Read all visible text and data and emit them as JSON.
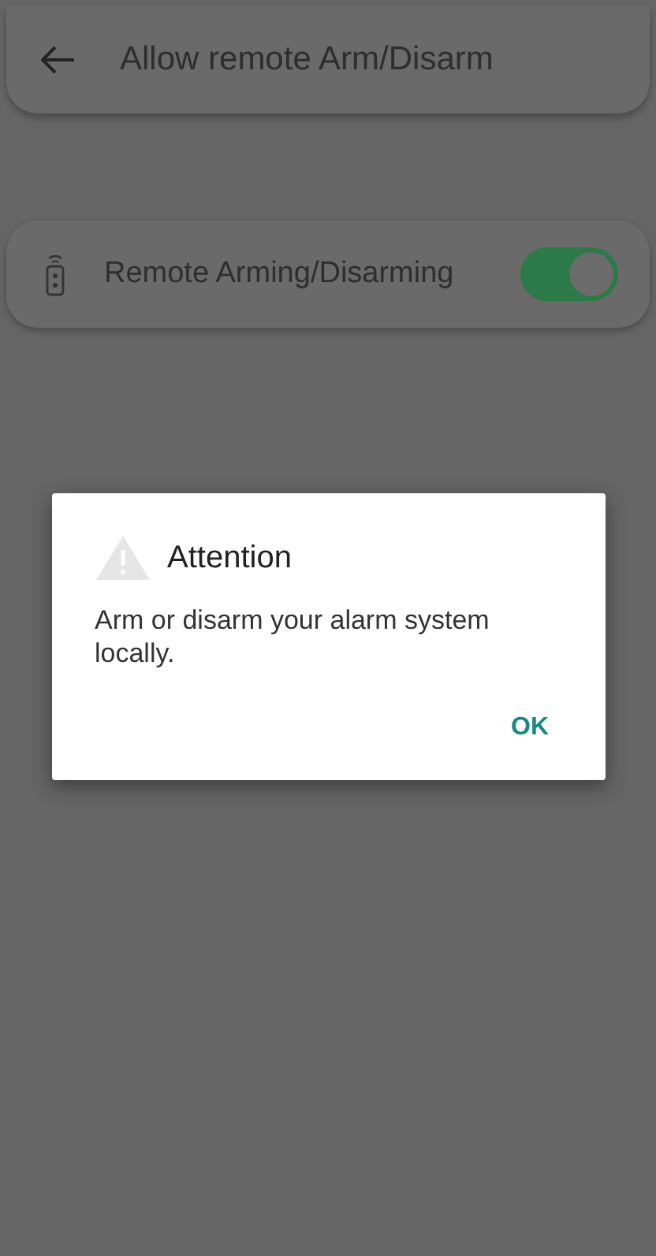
{
  "header": {
    "title": "Allow remote Arm/Disarm"
  },
  "setting": {
    "label": "Remote Arming/Disarming",
    "on": true
  },
  "dialog": {
    "title": "Attention",
    "message": "Arm or disarm your alarm system locally.",
    "buttons": [
      "OK"
    ]
  }
}
